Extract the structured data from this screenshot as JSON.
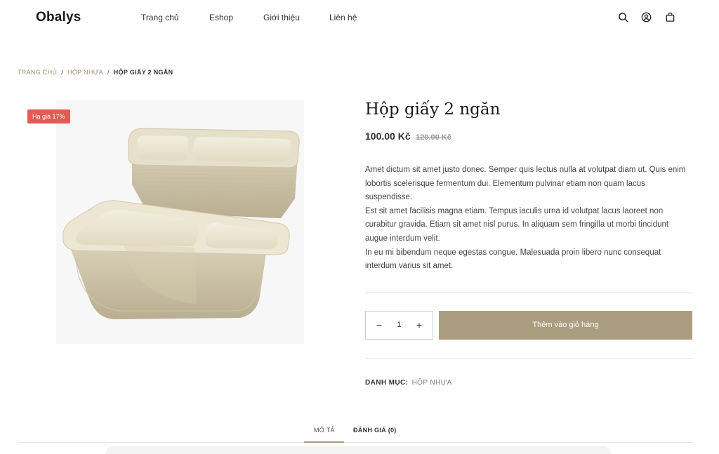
{
  "header": {
    "logo": "Obalys",
    "nav": [
      {
        "label": "Trang chủ"
      },
      {
        "label": "Eshop"
      },
      {
        "label": "Giới thiệu"
      },
      {
        "label": "Liên hệ"
      }
    ],
    "icons": [
      "search-icon",
      "user-icon",
      "cart-icon"
    ]
  },
  "breadcrumb": {
    "items": [
      "TRANG CHỦ",
      "HỘP NHỰA"
    ],
    "separator": "/",
    "current": "HỘP GIẤY 2 NGĂN"
  },
  "product": {
    "badge": "Hạ giá 17%",
    "title": "Hộp giấy 2 ngăn",
    "price": "100.00 Kč",
    "old_price": "120.00 Kč",
    "description": [
      "Amet dictum sit amet justo donec. Semper quis lectus nulla at volutpat diam ut. Quis enim lobortis scelerisque fermentum dui. Elementum pulvinar etiam non quam lacus suspendisse.",
      "Est sit amet facilisis magna etiam. Tempus iaculis urna id volutpat lacus laoreet non curabitur gravida. Etiam sit amet nisl purus. In aliquam sem fringilla ut morbi tincidunt augue interdum velit.",
      "In eu mi bibendum neque egestas congue. Malesuada proin libero nunc consequat interdum varius sit amet."
    ],
    "quantity": "1",
    "add_to_cart": "Thêm vào giỏ hàng",
    "category_label": "DANH MỤC:",
    "category_value": "HỘP NHỰA"
  },
  "tabs": [
    {
      "label": "MÔ TẢ",
      "active": true
    },
    {
      "label": "ĐÁNH GIÁ (0)",
      "active": false
    }
  ],
  "colors": {
    "accent": "#ab9e80",
    "sale_badge": "#e45a55",
    "breadcrumb_link": "#9c8f73"
  }
}
